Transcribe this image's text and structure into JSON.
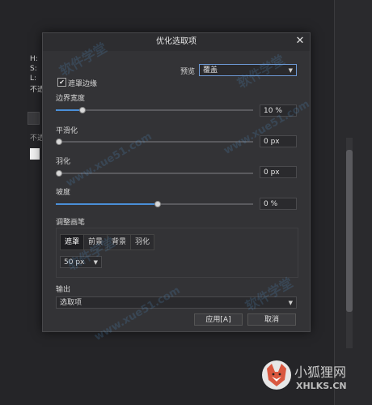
{
  "dialog": {
    "title": "优化选取项",
    "preview_label": "预览",
    "preview_value": "覆盖",
    "edge_checkbox_label": "遮罩边缘",
    "edge_checked": true,
    "border_width": {
      "label": "边界宽度",
      "value_text": "10 %",
      "fraction": 0.12
    },
    "smooth": {
      "label": "平滑化",
      "value_text": "0 px",
      "fraction": 0.0
    },
    "feather": {
      "label": "羽化",
      "value_text": "0 px",
      "fraction": 0.0
    },
    "ramp": {
      "label": "坡度",
      "value_text": "0 %",
      "fraction": 0.5
    },
    "brush": {
      "label": "调整画笔",
      "tabs": [
        "遮罩",
        "前景",
        "背景",
        "羽化"
      ],
      "active_tab": 0,
      "size_value": "50 px"
    },
    "output": {
      "label": "输出",
      "value": "选取项"
    },
    "apply_button": "应用[A]",
    "cancel_button": "取消"
  },
  "right_panel": {
    "h_label": "H:",
    "s_label": "S:",
    "l_label": "L:",
    "opacity_label": "不透",
    "row_label": "不透"
  },
  "watermark": {
    "text_cn": "软件学堂",
    "text_url": "www.xue51.com"
  },
  "logo": {
    "name": "小狐狸网",
    "domain": "XHLKS.CN"
  }
}
